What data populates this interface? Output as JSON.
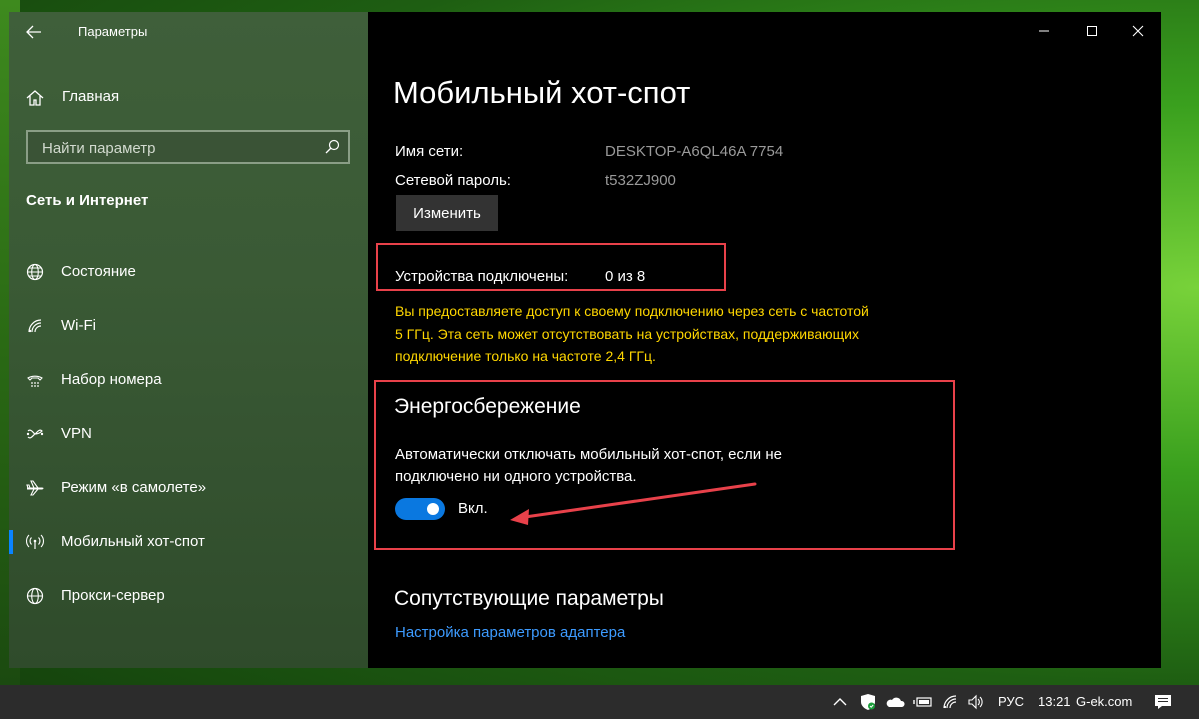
{
  "window": {
    "title": "Параметры"
  },
  "sidebar": {
    "home_label": "Главная",
    "search_placeholder": "Найти параметр",
    "section_title": "Сеть и Интернет",
    "items": [
      {
        "label": "Состояние",
        "icon": "globe-status-icon"
      },
      {
        "label": "Wi-Fi",
        "icon": "wifi-icon"
      },
      {
        "label": "Набор номера",
        "icon": "dialup-icon"
      },
      {
        "label": "VPN",
        "icon": "vpn-icon"
      },
      {
        "label": "Режим «в самолете»",
        "icon": "airplane-icon"
      },
      {
        "label": "Мобильный хот-спот",
        "icon": "hotspot-icon",
        "active": true
      },
      {
        "label": "Прокси-сервер",
        "icon": "globe-icon"
      }
    ]
  },
  "main": {
    "title": "Мобильный хот-спот",
    "network_name_label": "Имя сети:",
    "network_name_value": "DESKTOP-A6QL46A 7754",
    "password_label": "Сетевой пароль:",
    "password_value": "t532ZJ900",
    "change_button": "Изменить",
    "devices_label": "Устройства подключены:",
    "devices_value": "0 из 8",
    "warning_text": "Вы предоставляете доступ к своему подключению через сеть с частотой 5 ГГц. Эта сеть может отсутствовать на устройствах, поддерживающих подключение только на частоте 2,4 ГГц.",
    "energy_title": "Энергосбережение",
    "energy_desc": "Автоматически отключать мобильный хот-спот, если не подключено ни одного устройства.",
    "toggle_state": "Вкл.",
    "toggle_on": true,
    "related_title": "Сопутствующие параметры",
    "related_link": "Настройка параметров адаптера"
  },
  "taskbar": {
    "language": "РУС",
    "time": "13:21",
    "watermark": "G-ek.com"
  },
  "colors": {
    "accent": "#0a78e0",
    "warning": "#ffd700",
    "highlight_box": "#e8414a",
    "link": "#3d9bff"
  }
}
